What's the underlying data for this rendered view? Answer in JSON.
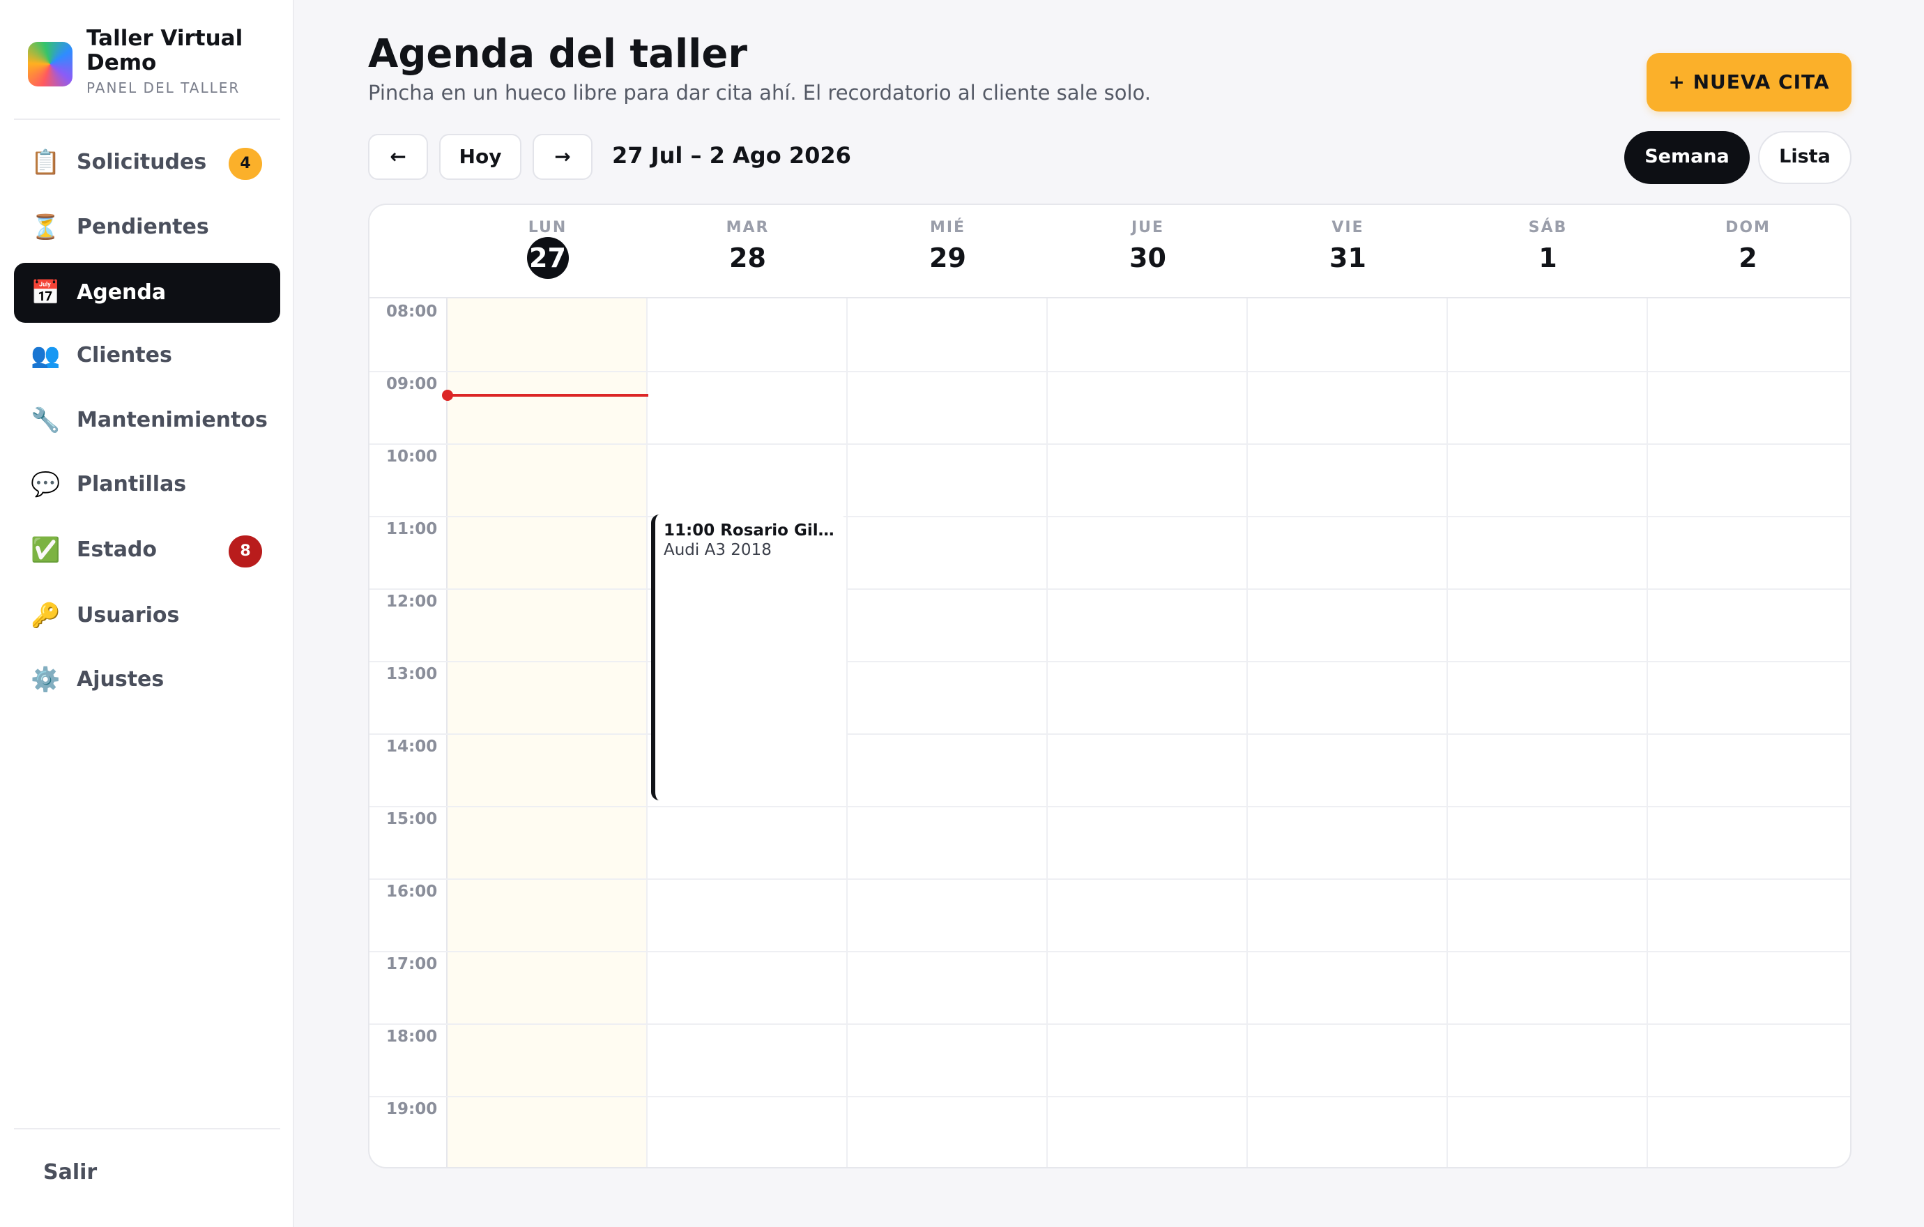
{
  "brand": {
    "name": "Taller Virtual Demo",
    "subtitle": "PANEL DEL TALLER"
  },
  "sidebar": {
    "items": [
      {
        "label": "Solicitudes",
        "icon": "📋",
        "badge": "4"
      },
      {
        "label": "Pendientes",
        "icon": "⏳",
        "badge": ""
      },
      {
        "label": "Agenda",
        "icon": "📅",
        "badge": "",
        "active": true
      },
      {
        "label": "Clientes",
        "icon": "👥",
        "badge": ""
      },
      {
        "label": "Mantenimientos",
        "icon": "🔧",
        "badge": ""
      },
      {
        "label": "Plantillas",
        "icon": "💬",
        "badge": ""
      },
      {
        "label": "Estado",
        "icon": "✅",
        "badge": "8"
      },
      {
        "label": "Usuarios",
        "icon": "🔑",
        "badge": ""
      },
      {
        "label": "Ajustes",
        "icon": "⚙️",
        "badge": ""
      }
    ],
    "logout_label": "Salir"
  },
  "header": {
    "title": "Agenda del taller",
    "subtitle": "Pincha en un hueco libre para dar cita ahí. El recordatorio al cliente sale solo.",
    "new_button": "+ NUEVA CITA"
  },
  "toolbar": {
    "prev": "←",
    "today": "Hoy",
    "next": "→",
    "range": "27 Jul – 2 Ago 2026",
    "views": [
      "Semana",
      "Lista"
    ],
    "active_view": "Semana"
  },
  "calendar": {
    "days": [
      {
        "dow": "LUN",
        "num": "27",
        "today": true
      },
      {
        "dow": "MAR",
        "num": "28"
      },
      {
        "dow": "MIÉ",
        "num": "29"
      },
      {
        "dow": "JUE",
        "num": "30"
      },
      {
        "dow": "VIE",
        "num": "31"
      },
      {
        "dow": "SÁB",
        "num": "1"
      },
      {
        "dow": "DOM",
        "num": "2"
      }
    ],
    "hours": [
      "08:00",
      "09:00",
      "10:00",
      "11:00",
      "12:00",
      "13:00",
      "14:00",
      "15:00",
      "16:00",
      "17:00",
      "18:00",
      "19:00"
    ],
    "events": [
      {
        "title": "11:00 Rosario Gil…",
        "subtitle": "Audi A3 2018"
      }
    ]
  },
  "colors": {
    "accent": "#fbb02a",
    "dark": "#0d0f14",
    "danger": "#b91c1c",
    "now_line": "#dc2626",
    "today_bg": "#fffcf2"
  }
}
